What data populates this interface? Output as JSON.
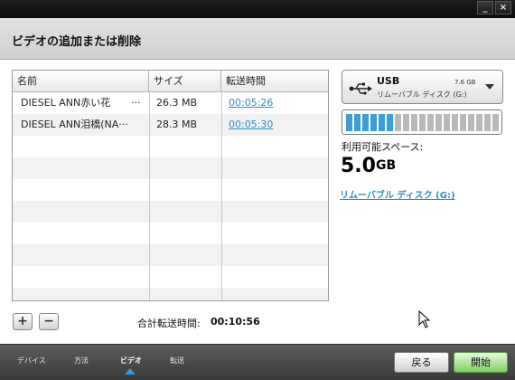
{
  "window": {
    "min_label": "_",
    "close_label": "×"
  },
  "header": {
    "title": "ビデオの追加または削除"
  },
  "table": {
    "columns": [
      "名前",
      "サイズ",
      "転送時間"
    ],
    "rows": [
      {
        "name": "DIESEL ANN赤い花",
        "ellipsis": "···",
        "size": "26.3 MB",
        "time": "00:05:26"
      },
      {
        "name": "DIESEL ANN泪橋(NA···",
        "ellipsis": "",
        "size": "28.3 MB",
        "time": "00:05:30"
      }
    ]
  },
  "toolbar": {
    "add_label": "+",
    "remove_label": "−"
  },
  "total": {
    "label": "合計転送時間:",
    "value": "00:10:56"
  },
  "device": {
    "name": "USB",
    "size": "7.6 GB",
    "subtitle": "リムーバブル ディスク (G:)",
    "icon": "usb-icon"
  },
  "capacity": {
    "used_fraction": 0.3,
    "used_color": "#3b9fd4",
    "free_color": "#b9b9b9"
  },
  "free_space": {
    "label": "利用可能スペース:",
    "value": "5.0",
    "unit": "GB"
  },
  "drive_link": "リムーバブル ディスク (G:)",
  "footer": {
    "steps": [
      "デバイス",
      "方法",
      "ビデオ",
      "転送"
    ],
    "active_step": 2,
    "back_label": "戻る",
    "start_label": "開始"
  },
  "colors": {
    "accent": "#2a8fc4",
    "start_button": "#7ecf5e"
  }
}
